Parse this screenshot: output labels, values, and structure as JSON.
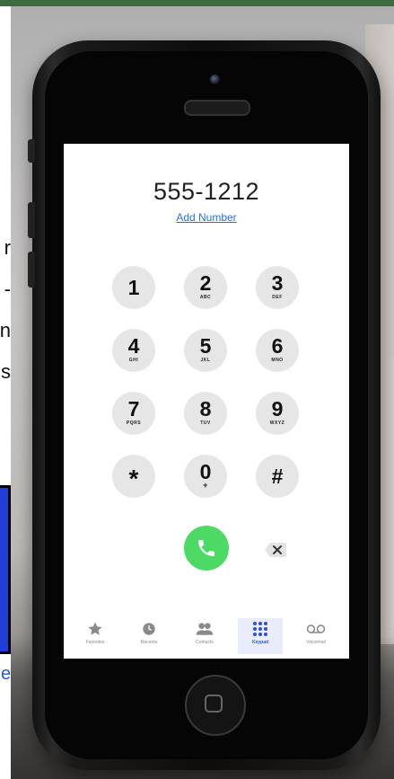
{
  "background_colors": {
    "top_bar": "#3f6b43",
    "blue_box": "#1f3fd6",
    "call_green": "#4cd964",
    "link_blue": "#2f6fd9"
  },
  "edge_text": {
    "lines": [
      "r",
      "-",
      "n",
      "s"
    ],
    "link_fragment": "e"
  },
  "dialer": {
    "number": "555-1212",
    "add_number_label": "Add Number",
    "keys": [
      {
        "digit": "1",
        "letters": ""
      },
      {
        "digit": "2",
        "letters": "ABC"
      },
      {
        "digit": "3",
        "letters": "DEF"
      },
      {
        "digit": "4",
        "letters": "GHI"
      },
      {
        "digit": "5",
        "letters": "JKL"
      },
      {
        "digit": "6",
        "letters": "MNO"
      },
      {
        "digit": "7",
        "letters": "PQRS"
      },
      {
        "digit": "8",
        "letters": "TUV"
      },
      {
        "digit": "9",
        "letters": "WXYZ"
      },
      {
        "digit": "*",
        "letters": ""
      },
      {
        "digit": "0",
        "letters": "+"
      },
      {
        "digit": "#",
        "letters": ""
      }
    ],
    "call_icon": "phone-handset-icon",
    "delete_icon": "backspace-icon"
  },
  "tabbar": {
    "active": "Keypad",
    "tabs": [
      {
        "label": "Favorites",
        "icon": "star-icon"
      },
      {
        "label": "Recents",
        "icon": "clock-icon"
      },
      {
        "label": "Contacts",
        "icon": "contacts-icon"
      },
      {
        "label": "Keypad",
        "icon": "keypad-grid-icon"
      },
      {
        "label": "Voicemail",
        "icon": "voicemail-icon"
      }
    ]
  }
}
